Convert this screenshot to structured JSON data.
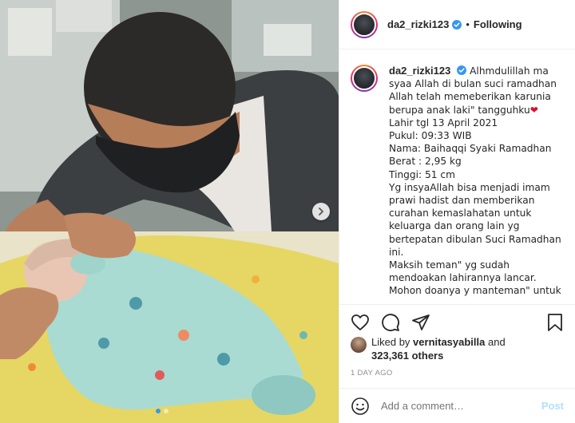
{
  "post": {
    "username": "da2_rizki123",
    "separator": "•",
    "follow_status": "Following"
  },
  "caption": {
    "username": "da2_rizki123",
    "text": "Alhmdulillah ma syaa Allah di bulan suci ramadhan Allah telah memeberikan karunia berupa anak laki\" tangguhku",
    "heart": "❤",
    "body": "Lahir tgl 13 April 2021\nPukul: 09:33 WIB\nNama: Baihaqqi Syaki Ramadhan\nBerat : 2,95 kg\nTinggi: 51 cm\nYg insyaAllah bisa menjadi imam prawi hadist dan memberikan curahan kemaslahatan untuk keluarga dan orang lain yg bertepatan dibulan Suci Ramadhan ini.\nMaksih teman\" yg sudah mendoakan lahirannya lancar.\nMohon doanya y manteman\" untuk"
  },
  "likes": {
    "prefix": "Liked by",
    "user": "vernitasyabilla",
    "and": "and",
    "others": "323,361 others"
  },
  "time": "1 DAY AGO",
  "comment": {
    "placeholder": "Add a comment…",
    "post_label": "Post"
  },
  "icons": {
    "verified": "verified-badge-icon",
    "like": "heart-icon",
    "comment": "comment-icon",
    "share": "share-icon",
    "save": "bookmark-icon",
    "emoji": "smiley-icon",
    "next": "chevron-right-icon"
  },
  "colors": {
    "verified_blue": "#3897f0",
    "post_button": "#b2dffc",
    "heart_red": "#d6112b",
    "muted": "#8e8e8e"
  },
  "carousel": {
    "total": 2,
    "active": 1
  }
}
